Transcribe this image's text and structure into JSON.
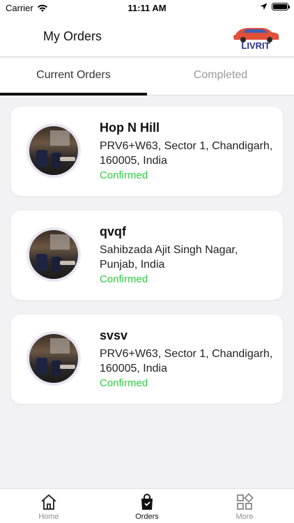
{
  "status_bar": {
    "carrier": "Carrier",
    "time": "11:11 AM"
  },
  "header": {
    "title": "My Orders",
    "logo_text": "LIVRIT"
  },
  "tabs": [
    {
      "label": "Current Orders",
      "active": true
    },
    {
      "label": "Completed",
      "active": false
    }
  ],
  "orders": [
    {
      "name": "Hop N Hill",
      "address": "PRV6+W63, Sector 1, Chandigarh, 160005, India",
      "status": "Confirmed"
    },
    {
      "name": "qvqf",
      "address": "Sahibzada Ajit Singh Nagar, Punjab, India",
      "status": "Confirmed"
    },
    {
      "name": "svsv",
      "address": "PRV6+W63, Sector 1, Chandigarh, 160005, India",
      "status": "Confirmed"
    }
  ],
  "tabbar": {
    "items": [
      {
        "label": "Home",
        "icon": "home-icon",
        "active": false
      },
      {
        "label": "Orders",
        "icon": "bag-icon",
        "active": true
      },
      {
        "label": "More",
        "icon": "grid-icon",
        "active": false
      }
    ]
  },
  "colors": {
    "accent": "#111111",
    "status_confirmed": "#2ecc40",
    "inactive": "#8e8e8e"
  }
}
